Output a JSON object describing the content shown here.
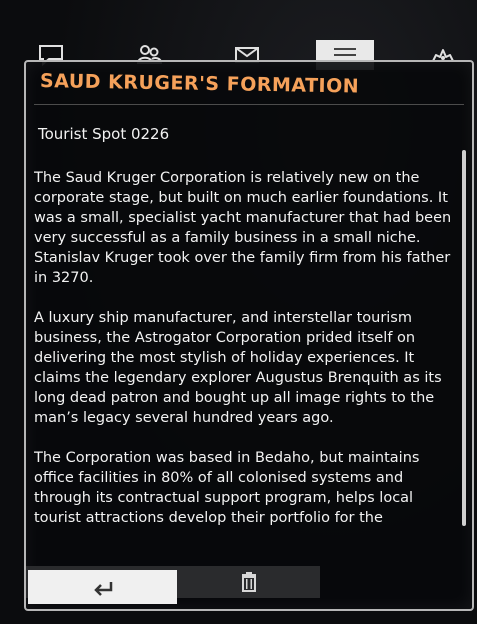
{
  "tabs": [
    {
      "icon": "chat-icon",
      "label": "Messages"
    },
    {
      "icon": "contacts-icon",
      "label": "Contacts"
    },
    {
      "icon": "mail-icon",
      "label": "Mail"
    },
    {
      "icon": "list-icon",
      "label": "Codex",
      "active": true
    },
    {
      "icon": "settings-cog-icon",
      "label": "Settings"
    }
  ],
  "panel": {
    "title": "SAUD KRUGER'S FORMATION",
    "subtitle": "Tourist Spot 0226",
    "paragraphs": [
      "The Saud Kruger Corporation is relatively new on the corporate stage, but built on much earlier foundations. It was a small, specialist yacht manufacturer that had been very successful as a family business in a small niche. Stanislav Kruger took over the family firm from his father in 3270.",
      "A luxury ship manufacturer, and interstellar tourism business, the Astrogator Corporation prided itself on delivering the most stylish of holiday experiences. It claims the legendary explorer Augustus Brenquith as its long dead patron and bought up all image rights to the man’s legacy several hundred years ago.",
      "The Corporation was based in Bedaho, but maintains office facilities in 80% of all colonised systems and through its contractual support program, helps local tourist attractions develop their portfolio for the"
    ]
  },
  "colors": {
    "title": "#f5a15a",
    "text": "#f2f2f2",
    "frame": "#b7b7b7"
  },
  "footer": {
    "back_icon": "back-arrow-icon",
    "delete_icon": "trash-icon"
  }
}
